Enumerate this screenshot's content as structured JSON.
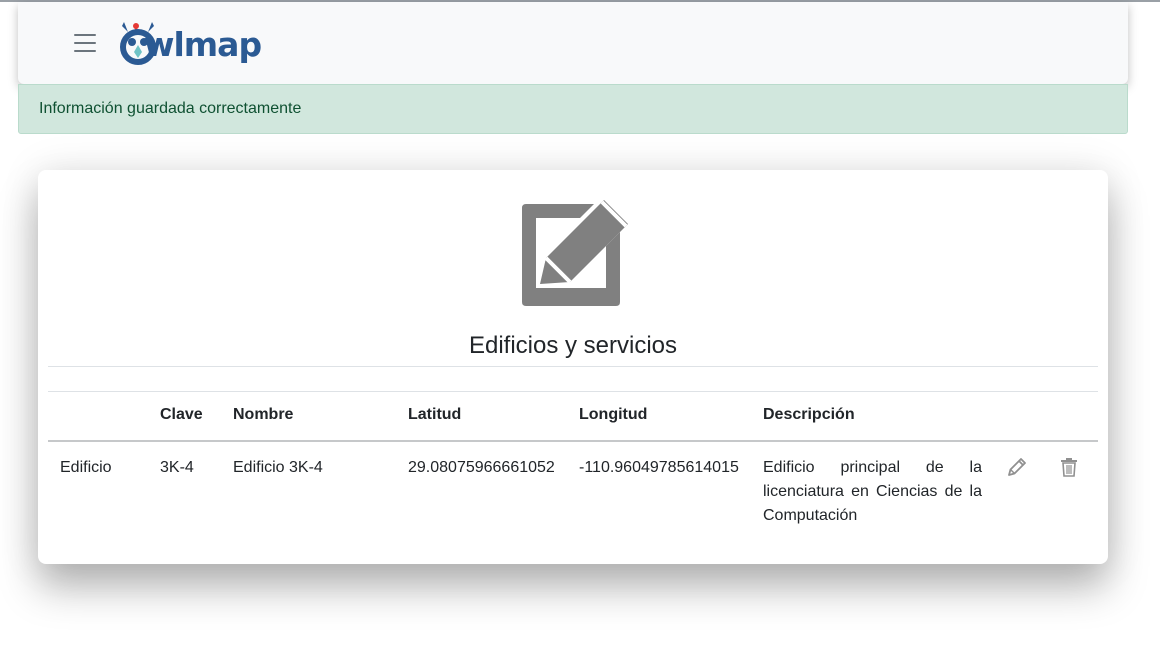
{
  "navbar": {
    "menu_icon": "hamburger-icon",
    "brand_text": "wlmap",
    "brand_logo": "owl-logo"
  },
  "alert": {
    "message": "Información guardada correctamente",
    "color": "#d1e7dd"
  },
  "card": {
    "icon": "edit-square-icon",
    "title": "Edificios y servicios"
  },
  "table": {
    "columns": [
      "",
      "Clave",
      "Nombre",
      "Latitud",
      "Longitud",
      "Descripción"
    ],
    "rows": [
      {
        "tipo": "Edificio",
        "clave": "3K-4",
        "nombre": "Edificio 3K-4",
        "latitud": "29.08075966661052",
        "longitud": "-110.96049785614015",
        "descripcion": "Edificio principal de la licenciatura en Ciencias de la Computación",
        "actions": [
          "pencil-icon",
          "trash-icon"
        ]
      }
    ]
  },
  "colors": {
    "brand": "#2b5a93",
    "icon_gray": "#808080",
    "alert_text": "#0f5132"
  }
}
